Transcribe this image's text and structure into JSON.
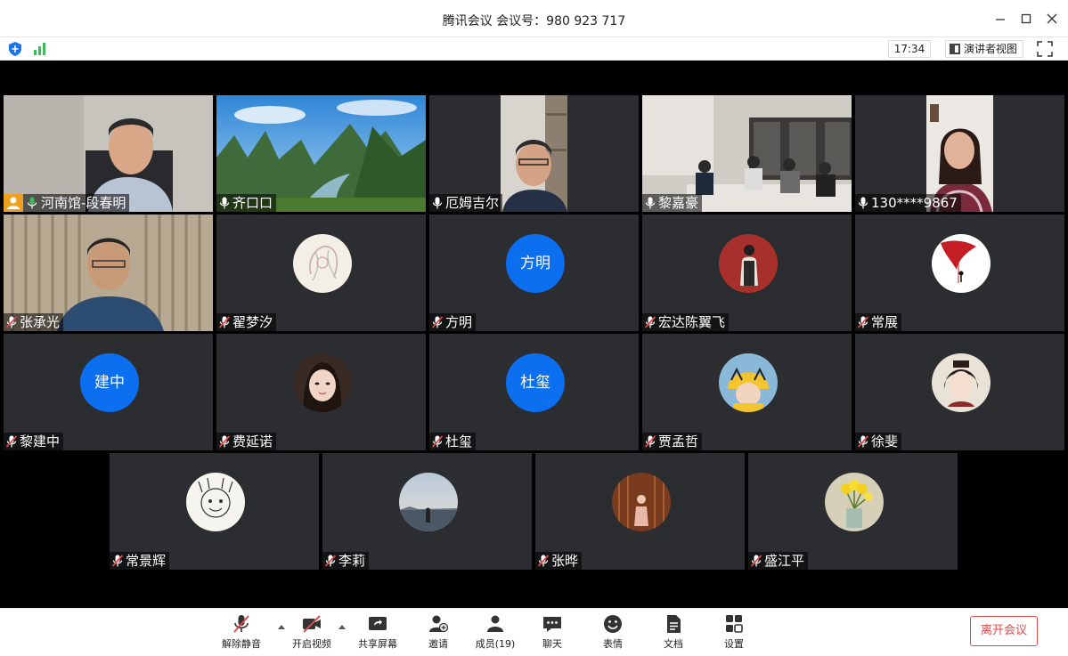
{
  "window": {
    "title": "腾讯会议 会议号：980 923 717"
  },
  "infobar": {
    "time": "17:34",
    "presenter_view": "演讲者视图"
  },
  "participants": [
    {
      "name": "河南馆-段春明",
      "mic": "on",
      "host": true
    },
    {
      "name": "齐口口",
      "mic": "on"
    },
    {
      "name": "厄姆吉尔",
      "mic": "on"
    },
    {
      "name": "黎嘉豪",
      "mic": "on"
    },
    {
      "name": "130****9867",
      "mic": "on"
    },
    {
      "name": "张承光",
      "mic": "muted"
    },
    {
      "name": "翟梦汐",
      "mic": "muted"
    },
    {
      "name": "方明",
      "mic": "muted",
      "avatar_text": "方明"
    },
    {
      "name": "宏达陈翼飞",
      "mic": "muted"
    },
    {
      "name": "常展",
      "mic": "muted"
    },
    {
      "name": "黎建中",
      "mic": "muted",
      "avatar_text": "建中"
    },
    {
      "name": "费延诺",
      "mic": "muted"
    },
    {
      "name": "杜玺",
      "mic": "muted",
      "avatar_text": "杜玺"
    },
    {
      "name": "贾孟哲",
      "mic": "muted"
    },
    {
      "name": "徐斐",
      "mic": "muted"
    },
    {
      "name": "常景辉",
      "mic": "muted"
    },
    {
      "name": "李莉",
      "mic": "muted"
    },
    {
      "name": "张晔",
      "mic": "muted"
    },
    {
      "name": "盛江平",
      "mic": "muted"
    }
  ],
  "toolbar": {
    "unmute": "解除静音",
    "start_video": "开启视频",
    "share_screen": "共享屏幕",
    "invite": "邀请",
    "members": "成员(19)",
    "chat": "聊天",
    "reactions": "表情",
    "docs": "文档",
    "settings": "设置",
    "leave": "离开会议"
  },
  "colors": {
    "accent": "#0b6ff0",
    "leave": "#e04848",
    "active_speaker": "#3bbd5a",
    "mic_on": "#3bbd5a",
    "mic_muted": "#e04848",
    "host": "#f0a020"
  }
}
